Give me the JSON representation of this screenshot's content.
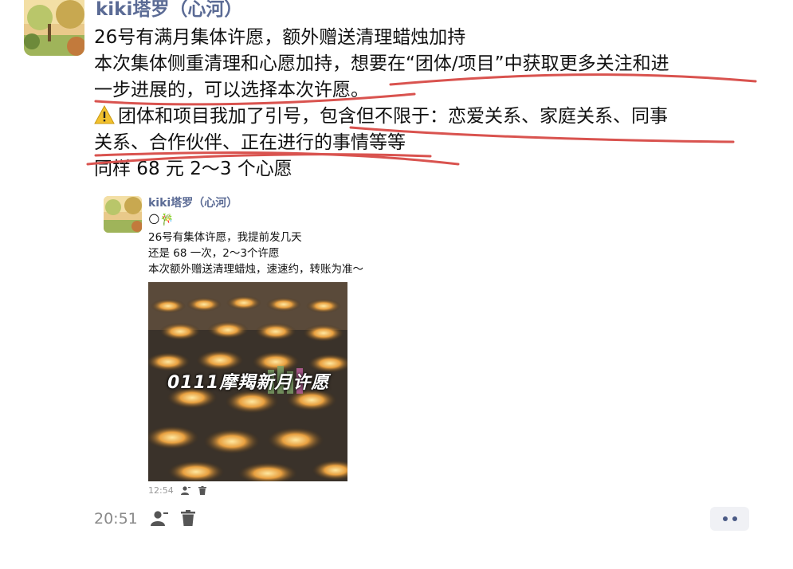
{
  "message": {
    "author": "kiki塔罗（心河）",
    "lines": [
      "26号有满月集体许愿，额外赠送清理蜡烛加持",
      "本次集体侧重清理和心愿加持，想要在“团体/项目”中获取更多关注和进",
      "一步进展的，可以选择本次许愿。",
      "团体和项目我加了引号，包含但不限于：恋爱关系、家庭关系、同事",
      "关系、合作伙伴、正在进行的事情等等",
      "同样 68 元 2～3 个心愿"
    ],
    "warning_icon": "warning-icon",
    "time": "20:51",
    "annotation_color": "#d9534f"
  },
  "quoted": {
    "author": "kiki塔罗（心河）",
    "emoji": "🌕🎋",
    "lines": [
      "26号有集体许愿，我提前发几天",
      "还是 68 一次，2～3个许愿",
      "本次额外赠送清理蜡烛，速速约，转账为准～"
    ],
    "photo_caption": "0111摩羯新月许愿",
    "time": "12:54"
  },
  "icons": [
    "user-icon",
    "trash-icon",
    "more-icon"
  ]
}
